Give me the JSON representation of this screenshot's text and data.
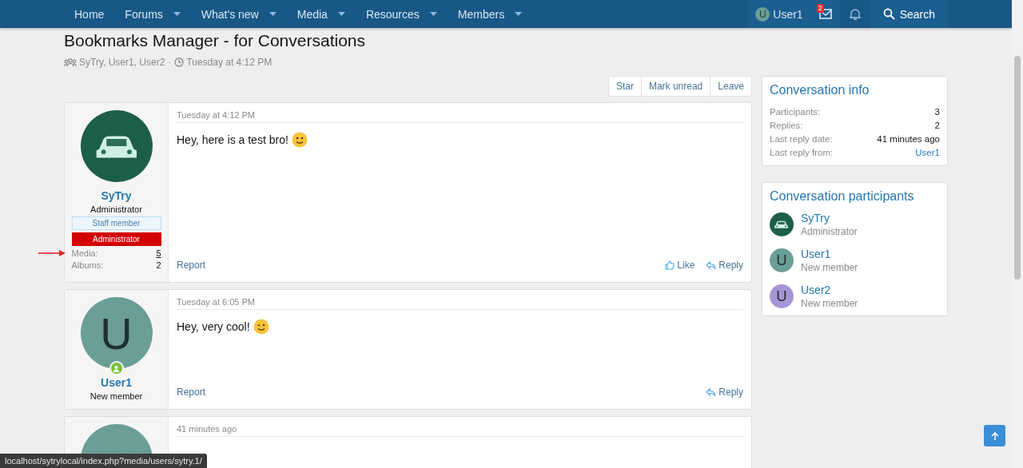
{
  "nav": {
    "items": [
      {
        "label": "Home",
        "dropdown": false
      },
      {
        "label": "Forums",
        "dropdown": true
      },
      {
        "label": "What's new",
        "dropdown": true
      },
      {
        "label": "Media",
        "dropdown": true
      },
      {
        "label": "Resources",
        "dropdown": true
      },
      {
        "label": "Members",
        "dropdown": true
      }
    ],
    "user": {
      "name": "User1",
      "initial": "U",
      "color": "#6a9e96"
    },
    "inbox_badge": "2",
    "search": "Search"
  },
  "title": "Bookmarks Manager - for Conversations",
  "meta": {
    "participants": "SyTry, User1, User2",
    "separator": "·",
    "time": "Tuesday at 4:12 PM"
  },
  "actions": [
    "Star",
    "Mark unread",
    "Leave"
  ],
  "messages": [
    {
      "author": "SyTry",
      "user_title": "Administrator",
      "avatar": {
        "kind": "photo",
        "color": "#1d5e48"
      },
      "online": false,
      "banners": [
        {
          "label": "Staff member",
          "kind": "staff"
        },
        {
          "label": "Administrator",
          "kind": "admin"
        }
      ],
      "stats": [
        {
          "label": "Media:",
          "value": "5",
          "link": true,
          "marked": true
        },
        {
          "label": "Albums:",
          "value": "2",
          "link": false,
          "marked": false
        }
      ],
      "time": "Tuesday at 4:12 PM",
      "body": "Hey, here is a test bro!",
      "emoji": {
        "kind": "smile"
      },
      "report": "Report",
      "like_label": "Like",
      "reply": "Reply"
    },
    {
      "author": "User1",
      "user_title": "New member",
      "avatar": {
        "kind": "letter",
        "initial": "U",
        "color": "#6a9e96"
      },
      "online": true,
      "time": "Tuesday at 6:05 PM",
      "body": "Hey, very cool!",
      "emoji": {
        "kind": "wink"
      },
      "report": "Report",
      "reply": "Reply"
    },
    {
      "avatar": {
        "kind": "plain",
        "color": "#6a9e96"
      },
      "online": false,
      "time": "41 minutes ago"
    }
  ],
  "info": {
    "title": "Conversation info",
    "rows": [
      {
        "label": "Participants:",
        "value": "3",
        "link": false
      },
      {
        "label": "Replies:",
        "value": "2",
        "link": false
      },
      {
        "label": "Last reply date:",
        "value": "41 minutes ago",
        "link": false
      },
      {
        "label": "Last reply from:",
        "value": "User1",
        "link": true
      }
    ]
  },
  "participants": {
    "title": "Conversation participants",
    "items": [
      {
        "name": "SyTry",
        "role": "Administrator",
        "avatar": {
          "kind": "photo",
          "color": "#1d5e48"
        }
      },
      {
        "name": "User1",
        "role": "New member",
        "avatar": {
          "kind": "letter",
          "initial": "U",
          "color": "#6a9e96"
        }
      },
      {
        "name": "User2",
        "role": "New member",
        "avatar": {
          "kind": "letter",
          "initial": "U",
          "color": "#a796d6"
        }
      }
    ]
  },
  "status_url": "localhost/sytrylocal/index.php?media/users/sytry.1/"
}
